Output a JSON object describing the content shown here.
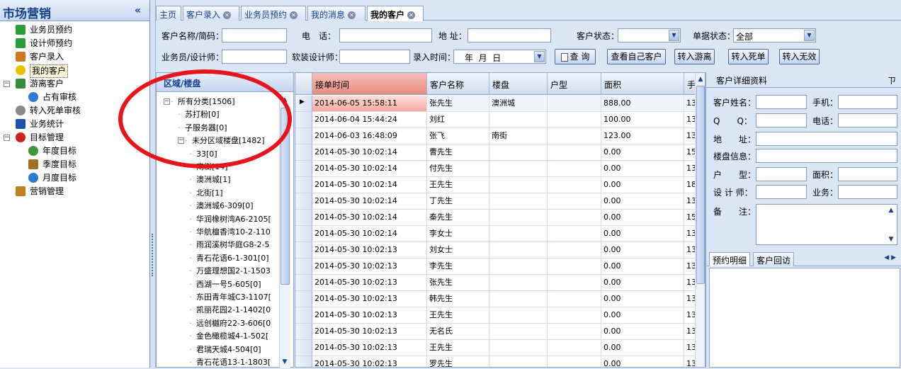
{
  "nav": {
    "title": "市场营销",
    "collapse": "«",
    "items": [
      {
        "label": "业务员预约",
        "icon": "phone-icon",
        "color": "#2e9b3a"
      },
      {
        "label": "设计师预约",
        "icon": "phone-icon",
        "color": "#2e9b3a"
      },
      {
        "label": "客户录入",
        "icon": "users-icon",
        "color": "#d07a20"
      },
      {
        "label": "我的客户",
        "icon": "smiley-icon",
        "color": "#e6c200"
      },
      {
        "label": "游离客户",
        "icon": "building-icon",
        "color": "#3a8c3a"
      },
      {
        "label": "占有审核",
        "icon": "dot-icon",
        "color": "#2a7bd4"
      },
      {
        "label": "转入死单审核",
        "icon": "gear-icon",
        "color": "#888888"
      },
      {
        "label": "业务统计",
        "icon": "chart-icon",
        "color": "#2050b0"
      },
      {
        "label": "目标管理",
        "icon": "target-icon",
        "color": "#d02020"
      },
      {
        "label": "年度目标",
        "icon": "globe-icon",
        "color": "#3a9a3a"
      },
      {
        "label": "季度目标",
        "icon": "hourglass-icon",
        "color": "#a07020"
      },
      {
        "label": "月度目标",
        "icon": "clock-icon",
        "color": "#2a7bd4"
      },
      {
        "label": "营销管理",
        "icon": "handshake-icon",
        "color": "#c08020"
      }
    ]
  },
  "tabs": [
    {
      "label": "主页"
    },
    {
      "label": "客户录入"
    },
    {
      "label": "业务员预约"
    },
    {
      "label": "我的消息"
    },
    {
      "label": "我的客户"
    }
  ],
  "filter": {
    "name_label": "客户名称/简码：",
    "phone_label": "电　话：",
    "addr_label": "地 址：",
    "status_label": "客户状态：",
    "docstatus_label": "单据状态：",
    "docstatus_value": "全部",
    "sales_label": "业务员/设计师：",
    "designer_label": "软装设计师：",
    "date_label": "录入时间：",
    "date_value": "年  月  日",
    "query": "查 询",
    "own": "查看自己客户",
    "free": "转入游离",
    "dead": "转入死单",
    "invalid": "转入无效"
  },
  "tree": {
    "header": "区域/楼盘",
    "nodes": [
      "所有分类[1506]",
      "苏打粉[0]",
      "子服务器[0]",
      "未分区域楼盘[1482]",
      "33[0]",
      "南衡[14]",
      "澳洲城[1]",
      "北街[1]",
      "澳洲城6-309[0]",
      "华润橡树湾A6-2105[",
      "华航檀香湾10-2-110",
      "雨润溪树华庭G8-2-5",
      "青石花语6-1-301[0]",
      "万盛理想国2-1-1503",
      "西湖一号5-605[0]",
      "东田青年城C3-1107[",
      "凯丽花园2-1-1402[0",
      "远创樾府22-3-606[0",
      "金色橄榄城4-1-502[",
      "君瑞天城4-504[0]",
      "青石花语13-1-1803["
    ]
  },
  "grid": {
    "columns": [
      "接单时间",
      "客户名称",
      "楼盘",
      "户型",
      "面积",
      "手"
    ],
    "rows": [
      [
        "2014-06-05 15:58:11",
        "张先生",
        "澳洲城",
        "",
        "888.00",
        "13"
      ],
      [
        "2014-06-04 15:44:24",
        "刘红",
        "",
        "",
        "100.00",
        "13"
      ],
      [
        "2014-06-03 16:48:09",
        "张飞",
        "南街",
        "",
        "123.00",
        "13"
      ],
      [
        "2014-05-30 10:02:14",
        "曹先生",
        "",
        "",
        "0.00",
        "15"
      ],
      [
        "2014-05-30 10:02:14",
        "付先生",
        "",
        "",
        "0.00",
        "13"
      ],
      [
        "2014-05-30 10:02:14",
        "王先生",
        "",
        "",
        "0.00",
        "18"
      ],
      [
        "2014-05-30 10:02:14",
        "丁先生",
        "",
        "",
        "0.00",
        "13"
      ],
      [
        "2014-05-30 10:02:14",
        "秦先生",
        "",
        "",
        "0.00",
        "15"
      ],
      [
        "2014-05-30 10:02:14",
        "李女士",
        "",
        "",
        "0.00",
        "13"
      ],
      [
        "2014-05-30 10:02:13",
        "刘女士",
        "",
        "",
        "0.00",
        "13"
      ],
      [
        "2014-05-30 10:02:13",
        "李先生",
        "",
        "",
        "0.00",
        "13"
      ],
      [
        "2014-05-30 10:02:13",
        "张先生",
        "",
        "",
        "0.00",
        "13"
      ],
      [
        "2014-05-30 10:02:13",
        "韩先生",
        "",
        "",
        "0.00",
        "13"
      ],
      [
        "2014-05-30 10:02:13",
        "王先生",
        "",
        "",
        "0.00",
        "13"
      ],
      [
        "2014-05-30 10:02:13",
        "无名氏",
        "",
        "",
        "0.00",
        "13"
      ],
      [
        "2014-05-30 10:02:13",
        "王先生",
        "",
        "",
        "0.00",
        "13"
      ],
      [
        "2014-05-30 10:02:13",
        "罗先生",
        "",
        "",
        "0.00",
        "13"
      ]
    ]
  },
  "detail": {
    "title": "客户详细资料",
    "pin": "ㄗ",
    "name": "客户姓名：",
    "mobile": "手机：",
    "qq": "Q　　Q：",
    "tel": "电话：",
    "addr": "地　　址：",
    "estate": "楼盘信息：",
    "house": "户　　型：",
    "area": "面积：",
    "designer": "设 计 师：",
    "biz": "业务：",
    "remark": "备　　注：",
    "tab1": "预约明细",
    "tab2": "客户回访"
  }
}
